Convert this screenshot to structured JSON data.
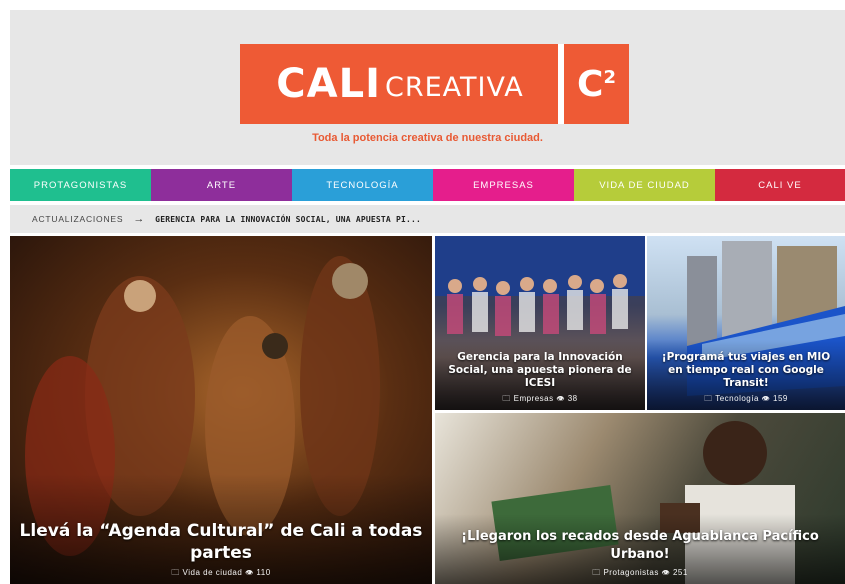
{
  "header": {
    "logo_main": "CALI",
    "logo_secondary": "CREATIVA",
    "logo_mark": "C",
    "logo_mark_sup": "2",
    "tagline": "Toda la potencia creativa de nuestra ciudad.",
    "logo_color": "#ee5a35"
  },
  "nav": {
    "items": [
      {
        "label": "PROTAGONISTAS",
        "color": "#1fbf8f"
      },
      {
        "label": "ARTE",
        "color": "#8e2e9b"
      },
      {
        "label": "TECNOLOGÍA",
        "color": "#2a9fd8"
      },
      {
        "label": "EMPRESAS",
        "color": "#e51e8c"
      },
      {
        "label": "VIDA DE CIUDAD",
        "color": "#b6cc3a"
      },
      {
        "label": "CALI VE",
        "color": "#d42a3f"
      }
    ]
  },
  "ticker": {
    "label": "ACTUALIZACIONES",
    "arrow": "→",
    "headline": "GERENCIA PARA LA INNOVACIÓN SOCIAL, UNA APUESTA PI..."
  },
  "cards": [
    {
      "title": "Llevá la “Agenda Cultural” de Cali a todas partes",
      "category": "Vida de ciudad",
      "views": "110"
    },
    {
      "title": "Gerencia para la Innovación Social, una apuesta pionera de ICESI",
      "category": "Empresas",
      "views": "38"
    },
    {
      "title": "¡Programá tus viajes en MIO en tiempo real con Google Transit!",
      "category": "Tecnología",
      "views": "159"
    },
    {
      "title": "¡Llegaron los recados desde Aguablanca Pacífico Urbano!",
      "category": "Protagonistas",
      "views": "251"
    }
  ],
  "icons": {
    "folder": "folder-icon",
    "eye": "eye-icon"
  }
}
